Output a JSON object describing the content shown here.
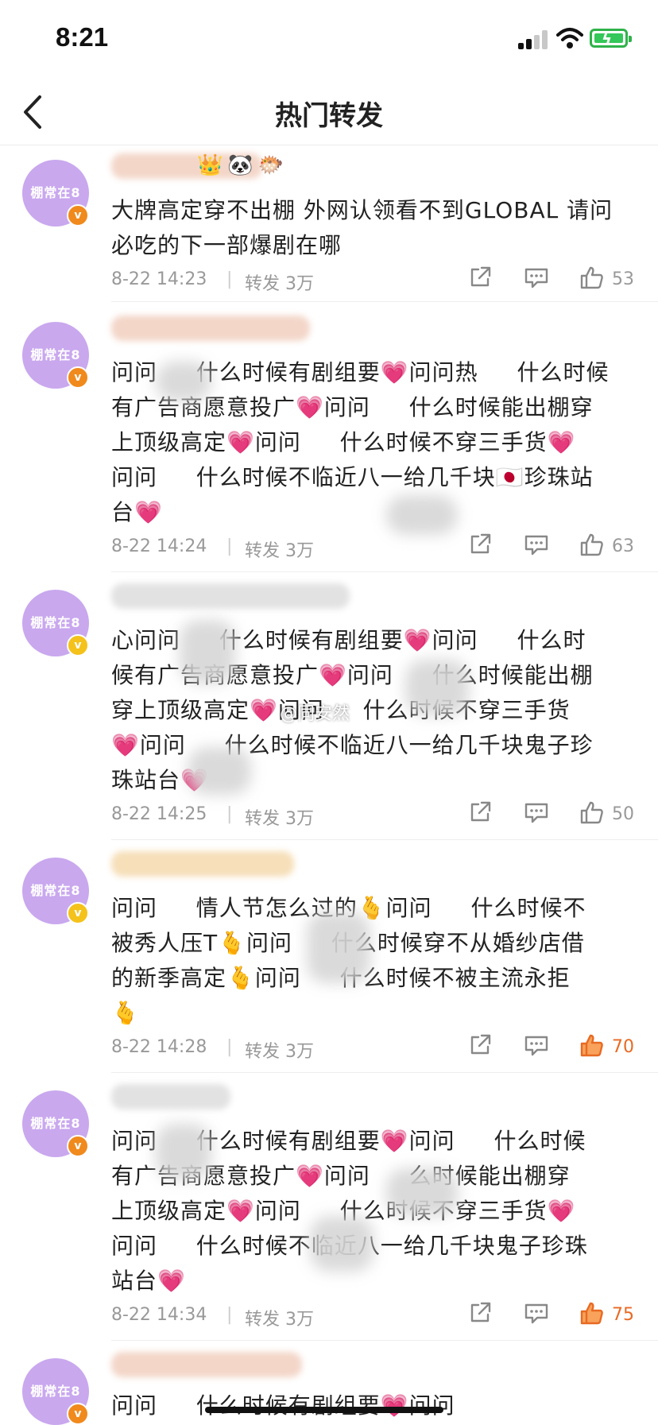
{
  "status_bar": {
    "time": "8:21"
  },
  "nav": {
    "title": "热门转发"
  },
  "watermark": "@同安然",
  "colors": {
    "like_active": "#e86a23",
    "meta_grey": "#999999",
    "avatar_bg": "#c9a8ee"
  },
  "items": [
    {
      "avatar_text": "棚常在8",
      "badge": "orange",
      "text_lines": [
        "大牌高定穿不出棚 外网认领看不到GLOBAL 请问",
        "必吃的下一部爆剧在哪"
      ],
      "date": "8-22 14:23",
      "repost": "转发 3万",
      "likes": "53",
      "liked": false
    },
    {
      "avatar_text": "棚常在8",
      "badge": "orange",
      "text_lines": [
        "问问 　 什么时候有剧组要💗问问热 　 什么时候",
        "有广告商愿意投广💗问问 　 什么时候能出棚穿",
        "上顶级高定💗问问 　 什么时候不穿三手货💗",
        "问问 　 什么时候不临近八一给几千块🇯🇵珍珠站",
        "台💗"
      ],
      "date": "8-22 14:24",
      "repost": "转发 3万",
      "likes": "63",
      "liked": false
    },
    {
      "avatar_text": "棚常在8",
      "badge": "yellow",
      "text_lines": [
        "心问问 　 什么时候有剧组要💗问问 　 什么时",
        "候有广告商愿意投广💗问问 　 什么时候能出棚",
        "穿上顶级高定💗问问 　 什么时候不穿三手货",
        "💗问问 　 什么时候不临近八一给几千块鬼子珍",
        "珠站台💗"
      ],
      "date": "8-22 14:25",
      "repost": "转发 3万",
      "likes": "50",
      "liked": false
    },
    {
      "avatar_text": "棚常在8",
      "badge": "yellow",
      "text_lines": [
        "问问 　 情人节怎么过的🫰问问 　 什么时候不",
        "被秀人压T🫰问问 　 什么时候穿不从婚纱店借",
        "的新季高定🫰问问 　 什么时候不被主流永拒",
        "🫰"
      ],
      "date": "8-22 14:28",
      "repost": "转发 3万",
      "likes": "70",
      "liked": true
    },
    {
      "avatar_text": "棚常在8",
      "badge": "orange",
      "text_lines": [
        "问问 　 什么时候有剧组要💗问问 　 什么时候",
        "有广告商愿意投广💗问问 　 么时候能出棚穿",
        "上顶级高定💗问问 　 什么时候不穿三手货💗",
        "问问 　 什么时候不临近八一给几千块鬼子珍珠",
        "站台💗"
      ],
      "date": "8-22 14:34",
      "repost": "转发 3万",
      "likes": "75",
      "liked": true
    },
    {
      "avatar_text": "棚常在8",
      "badge": "orange",
      "text_lines": [
        "问问 　 什么时候有剧组要💗问问"
      ],
      "date": "",
      "repost": "",
      "likes": "",
      "liked": false
    }
  ]
}
